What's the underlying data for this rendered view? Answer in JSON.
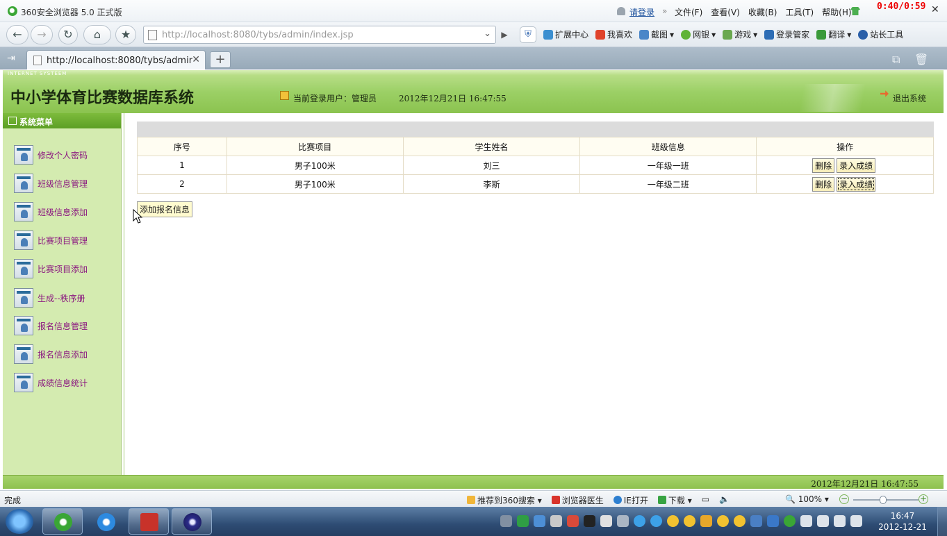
{
  "browser": {
    "title": "360安全浏览器 5.0 正式版",
    "login_link": "请登录",
    "separator": "»",
    "menu": [
      "文件(F)",
      "查看(V)",
      "收藏(B)",
      "工具(T)",
      "帮助(H)"
    ],
    "timer": "0:40/0:59",
    "url": "http://localhost:8080/tybs/admin/index.jsp",
    "toolbar": [
      "扩展中心",
      "我喜欢",
      "截图",
      "网银",
      "游戏",
      "登录管家",
      "翻译",
      "站长工具"
    ],
    "tab_title": "http://localhost:8080/tybs/admin/i...",
    "status": "完成",
    "statusbar_items": [
      "推荐到360搜索",
      "浏览器医生",
      "IE打开",
      "下载"
    ],
    "zoom": "100%"
  },
  "app": {
    "tag": "INTERNET SYSTEEM",
    "title": "中小学体育比赛数据库系统",
    "current_user": "当前登录用户：管理员",
    "datetime": "2012年12月21日  16:47:55",
    "logout": "退出系统",
    "sidebar": {
      "heading": "系统菜单",
      "items": [
        {
          "label": "修改个人密码"
        },
        {
          "label": "班级信息管理"
        },
        {
          "label": "班级信息添加"
        },
        {
          "label": "比赛项目管理"
        },
        {
          "label": "比赛项目添加"
        },
        {
          "label": "生成--秩序册"
        },
        {
          "label": "报名信息管理"
        },
        {
          "label": "报名信息添加"
        },
        {
          "label": "成绩信息统计"
        }
      ]
    },
    "table": {
      "headers": [
        "序号",
        "比赛项目",
        "学生姓名",
        "班级信息",
        "操作"
      ],
      "rows": [
        {
          "no": "1",
          "event": "男子100米",
          "student": "刘三",
          "class": "一年级一班"
        },
        {
          "no": "2",
          "event": "男子100米",
          "student": "李斯",
          "class": "一年级二班"
        }
      ],
      "delete_label": "删除",
      "enter_score_label": "录入成绩"
    },
    "add_button": "添加报名信息",
    "footer_time": "2012年12月21日  16:47:55"
  },
  "taskbar": {
    "time": "16:47",
    "date": "2012-12-21"
  }
}
